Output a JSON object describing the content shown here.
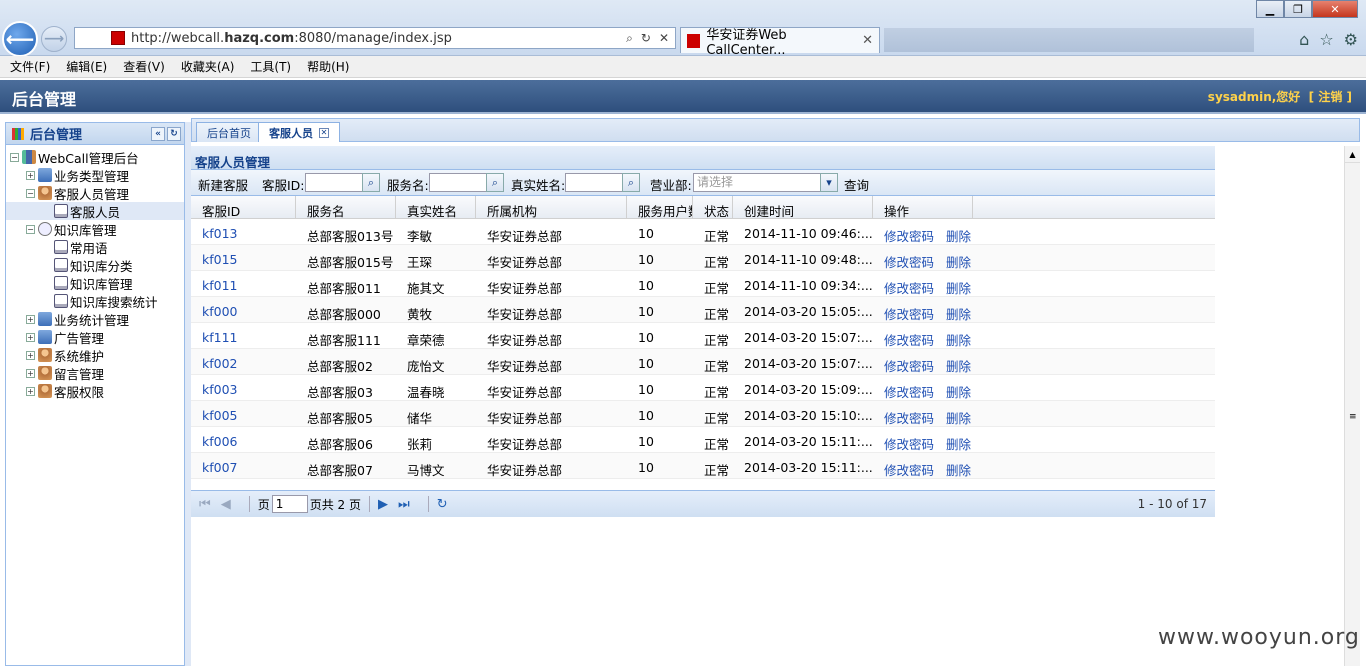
{
  "browser": {
    "url_prefix": "http://webcall.",
    "url_domain": "hazq.com",
    "url_rest": ":8080/manage/index.jsp",
    "tab_title": "华安证券Web CallCenter...",
    "tab_close": "✕",
    "win_min": "▁",
    "win_max": "❐",
    "win_close": "✕"
  },
  "menubar": {
    "items": [
      "文件(F)",
      "编辑(E)",
      "查看(V)",
      "收藏夹(A)",
      "工具(T)",
      "帮助(H)"
    ]
  },
  "header": {
    "title": "后台管理",
    "user": "sysadmin,您好",
    "logout": "[ 注销 ]"
  },
  "sidebar": {
    "title": "后台管理",
    "tree": [
      {
        "label": "WebCall管理后台",
        "toggle": "−",
        "level": 0,
        "icon": "net"
      },
      {
        "label": "业务类型管理",
        "toggle": "+",
        "level": 1,
        "icon": "folder"
      },
      {
        "label": "客服人员管理",
        "toggle": "−",
        "level": 1,
        "icon": "person"
      },
      {
        "label": "客服人员",
        "toggle": "",
        "level": 2,
        "icon": "doc",
        "selected": true
      },
      {
        "label": "知识库管理",
        "toggle": "−",
        "level": 1,
        "icon": "mag"
      },
      {
        "label": "常用语",
        "toggle": "",
        "level": 2,
        "icon": "doc"
      },
      {
        "label": "知识库分类",
        "toggle": "",
        "level": 2,
        "icon": "doc"
      },
      {
        "label": "知识库管理",
        "toggle": "",
        "level": 2,
        "icon": "doc"
      },
      {
        "label": "知识库搜索统计",
        "toggle": "",
        "level": 2,
        "icon": "doc"
      },
      {
        "label": "业务统计管理",
        "toggle": "+",
        "level": 1,
        "icon": "folder"
      },
      {
        "label": "广告管理",
        "toggle": "+",
        "level": 1,
        "icon": "folder"
      },
      {
        "label": "系统维护",
        "toggle": "+",
        "level": 1,
        "icon": "person"
      },
      {
        "label": "留言管理",
        "toggle": "+",
        "level": 1,
        "icon": "person"
      },
      {
        "label": "客服权限",
        "toggle": "+",
        "level": 1,
        "icon": "person"
      }
    ]
  },
  "tabs": {
    "home": "后台首页",
    "current": "客服人员"
  },
  "grid": {
    "title": "客服人员管理",
    "toolbar": {
      "new_btn": "新建客服",
      "id_label": "客服ID:",
      "svc_label": "服务名:",
      "name_label": "真实姓名:",
      "dept_label": "营业部:",
      "dept_placeholder": "请选择",
      "query": "查询"
    },
    "columns": [
      "客服ID",
      "服务名",
      "真实姓名",
      "所属机构",
      "服务用户数",
      "状态",
      "创建时间",
      "操作"
    ],
    "rows": [
      [
        "kf013",
        "总部客服013号",
        "李敏",
        "华安证券总部",
        "10",
        "正常",
        "2014-11-10 09:46:..."
      ],
      [
        "kf015",
        "总部客服015号",
        "王琛",
        "华安证券总部",
        "10",
        "正常",
        "2014-11-10 09:48:..."
      ],
      [
        "kf011",
        "总部客服011",
        "施其文",
        "华安证券总部",
        "10",
        "正常",
        "2014-11-10 09:34:..."
      ],
      [
        "kf000",
        "总部客服000",
        "黄牧",
        "华安证券总部",
        "10",
        "正常",
        "2014-03-20 15:05:..."
      ],
      [
        "kf111",
        "总部客服111",
        "章荣德",
        "华安证券总部",
        "10",
        "正常",
        "2014-03-20 15:07:..."
      ],
      [
        "kf002",
        "总部客服02",
        "庞怡文",
        "华安证券总部",
        "10",
        "正常",
        "2014-03-20 15:07:..."
      ],
      [
        "kf003",
        "总部客服03",
        "温春晓",
        "华安证券总部",
        "10",
        "正常",
        "2014-03-20 15:09:..."
      ],
      [
        "kf005",
        "总部客服05",
        "储华",
        "华安证券总部",
        "10",
        "正常",
        "2014-03-20 15:10:..."
      ],
      [
        "kf006",
        "总部客服06",
        "张莉",
        "华安证券总部",
        "10",
        "正常",
        "2014-03-20 15:11:..."
      ],
      [
        "kf007",
        "总部客服07",
        "马博文",
        "华安证券总部",
        "10",
        "正常",
        "2014-03-20 15:11:..."
      ]
    ],
    "op_edit": "修改密码",
    "op_delete": "删除"
  },
  "pager": {
    "page_label": "页",
    "page_value": "1",
    "total_label": "页共 2 页",
    "summary": "1 - 10 of 17"
  },
  "watermark": "www.wooyun.org"
}
